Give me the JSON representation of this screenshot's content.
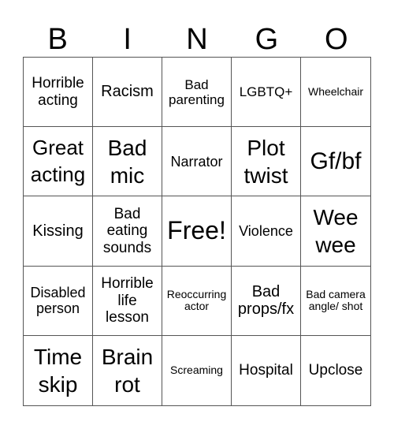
{
  "header": [
    "B",
    "I",
    "N",
    "G",
    "O"
  ],
  "cells": [
    "Horrible acting",
    "Racism",
    "Bad parenting",
    "LGBTQ+",
    "Wheelchair",
    "Great acting",
    "Bad mic",
    "Narrator",
    "Plot twist",
    "Gf/bf",
    "Kissing",
    "Bad eating sounds",
    "Free!",
    "Violence",
    "Wee wee",
    "Disabled person",
    "Horrible life lesson",
    "Reoccurring actor",
    "Bad props/fx",
    "Bad camera angle/ shot",
    "Time skip",
    "Brain rot",
    "Screaming",
    "Hospital",
    "Upclose"
  ]
}
